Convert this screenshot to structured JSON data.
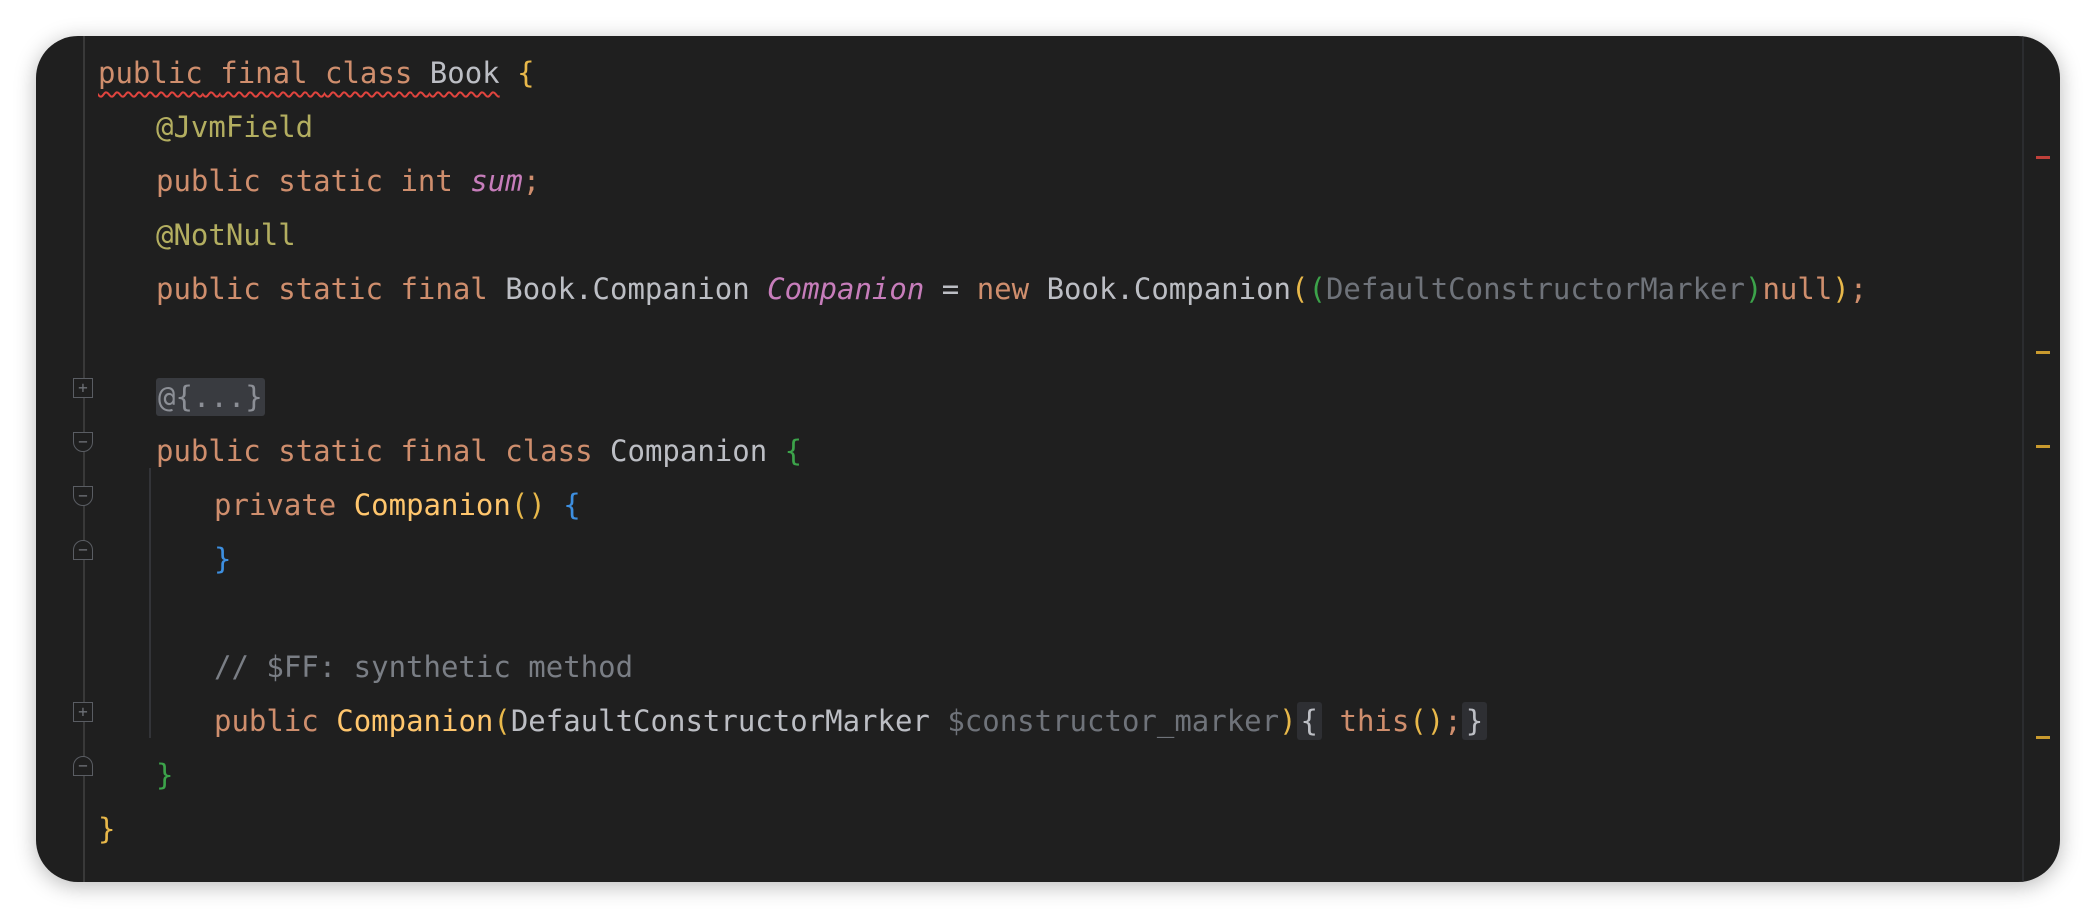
{
  "code": {
    "line1": {
      "kw_public": "public",
      "kw_final": "final",
      "kw_class": "class",
      "cls_name": "Book",
      "brace": "{"
    },
    "line2": {
      "annotation": "@JvmField"
    },
    "line3": {
      "kw_public": "public",
      "kw_static": "static",
      "kw_int": "int",
      "field": "sum",
      "semi": ";"
    },
    "line4": {
      "annotation": "@NotNull"
    },
    "line5": {
      "kw_public": "public",
      "kw_static": "static",
      "kw_final": "final",
      "type": "Book.Companion",
      "field": "Companion",
      "eq": "=",
      "kw_new": "new",
      "ctor": "Book.Companion",
      "open_paren": "(",
      "cast_open": "(",
      "cast_type": "DefaultConstructorMarker",
      "cast_close": ")",
      "kw_null": "null",
      "close_paren": ")",
      "semi": ";"
    },
    "line7": {
      "folded": "@{...}"
    },
    "line8": {
      "kw_public": "public",
      "kw_static": "static",
      "kw_final": "final",
      "kw_class": "class",
      "cls_name": "Companion",
      "brace": "{"
    },
    "line9": {
      "kw_private": "private",
      "method": "Companion",
      "parens": "()",
      "brace": "{"
    },
    "line10": {
      "brace": "}"
    },
    "line12": {
      "comment": "// $FF: synthetic method"
    },
    "line13": {
      "kw_public": "public",
      "method": "Companion",
      "open_paren": "(",
      "param_type": "DefaultConstructorMarker",
      "param_name": "$constructor_marker",
      "close_paren": ")",
      "body_open": "{",
      "kw_this": "this",
      "call": "()",
      "semi": ";",
      "body_close": "}"
    },
    "line14": {
      "brace": "}"
    },
    "line15": {
      "brace": "}"
    }
  },
  "colors": {
    "background": "#1f1f1f",
    "keyword": "#cf8e6d",
    "annotation": "#b3ae60",
    "field": "#c77dbb",
    "method": "#ffc66d",
    "comment": "#7a7e85",
    "error_underline": "#e0443e",
    "warning_marker": "#c99a2e"
  },
  "icons": {
    "fold_expand": "plus-box-icon",
    "fold_collapse": "minus-box-icon"
  }
}
